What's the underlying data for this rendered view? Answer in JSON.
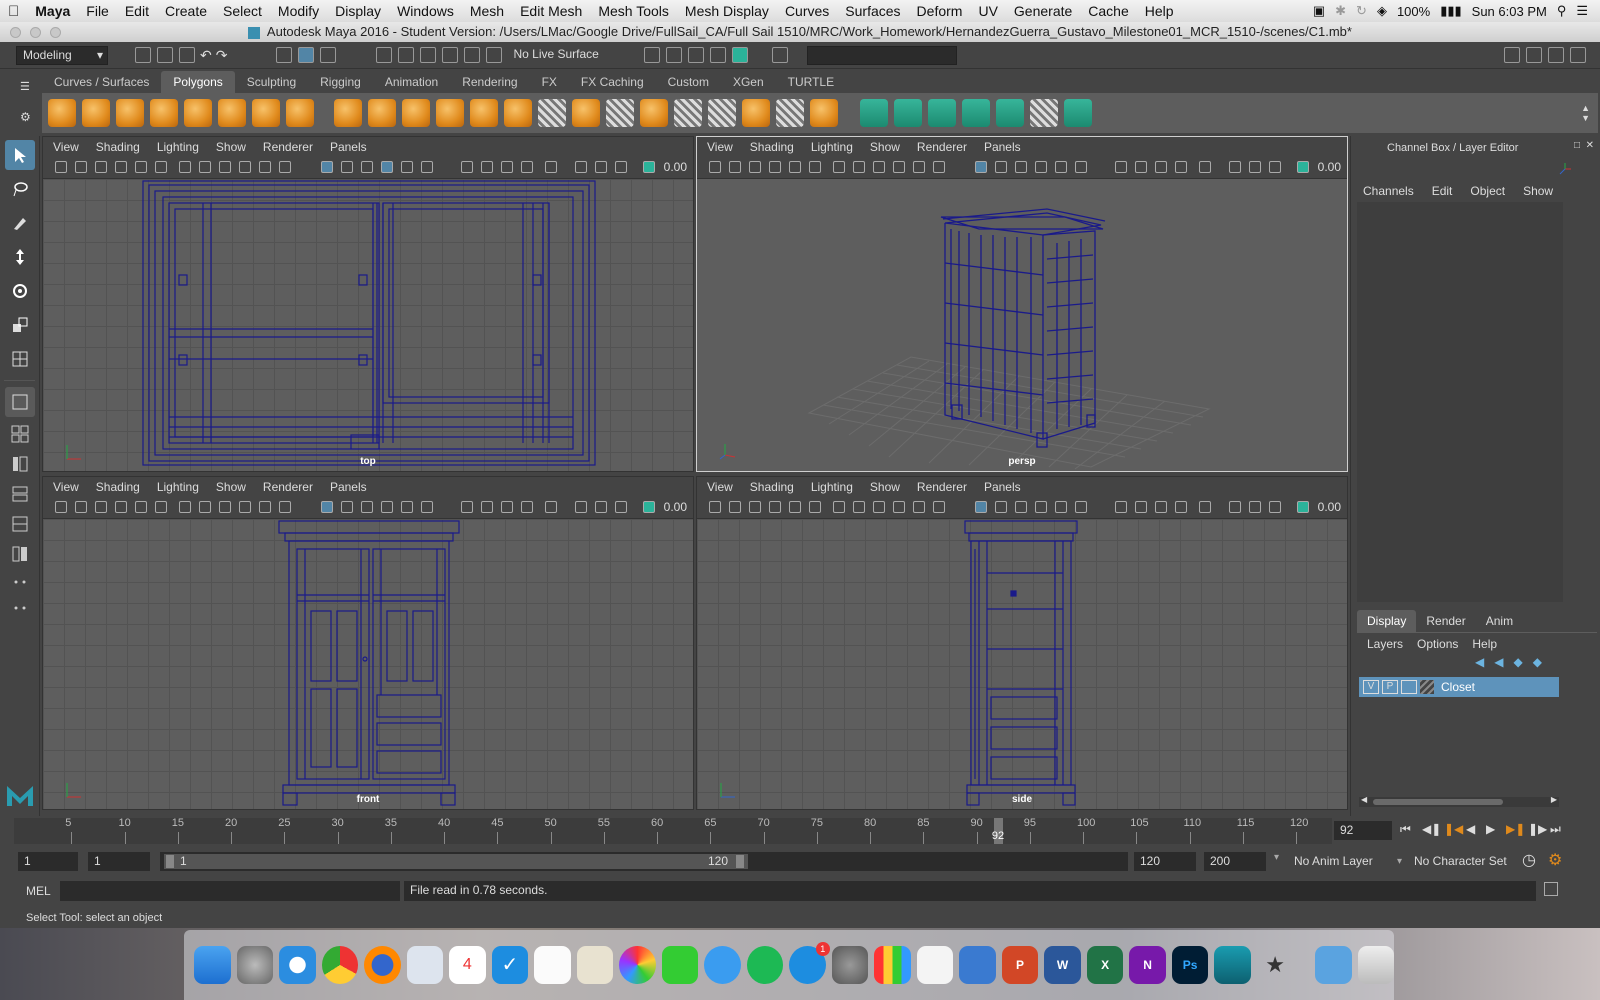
{
  "mac_menubar": {
    "app_name": "Maya",
    "menus": [
      "File",
      "Edit",
      "Create",
      "Select",
      "Modify",
      "Display",
      "Windows",
      "Mesh",
      "Edit Mesh",
      "Mesh Tools",
      "Mesh Display",
      "Curves",
      "Surfaces",
      "Deform",
      "UV",
      "Generate",
      "Cache",
      "Help"
    ],
    "battery": "100%",
    "clock": "Sun 6:03 PM"
  },
  "window_title": "Autodesk Maya 2016 - Student Version: /Users/LMac/Google Drive/FullSail_CA/Full Sail 1510/MRC/Work_Homework/HernandezGuerra_Gustavo_Milestone01_MCR_1510-/scenes/C1.mb*",
  "status_line": {
    "menu_set": "Modeling",
    "live_surface": "No Live Surface"
  },
  "shelf": {
    "tabs": [
      "Curves / Surfaces",
      "Polygons",
      "Sculpting",
      "Rigging",
      "Animation",
      "Rendering",
      "FX",
      "FX Caching",
      "Custom",
      "XGen",
      "TURTLE"
    ],
    "active_tab": "Polygons"
  },
  "viewports": [
    {
      "camera": "top",
      "menus": [
        "View",
        "Shading",
        "Lighting",
        "Show",
        "Renderer",
        "Panels"
      ],
      "value": "0.00"
    },
    {
      "camera": "persp",
      "menus": [
        "View",
        "Shading",
        "Lighting",
        "Show",
        "Renderer",
        "Panels"
      ],
      "value": "0.00"
    },
    {
      "camera": "front",
      "menus": [
        "View",
        "Shading",
        "Lighting",
        "Show",
        "Renderer",
        "Panels"
      ],
      "value": "0.00"
    },
    {
      "camera": "side",
      "menus": [
        "View",
        "Shading",
        "Lighting",
        "Show",
        "Renderer",
        "Panels"
      ],
      "value": "0.00"
    }
  ],
  "channel_box": {
    "title": "Channel Box / Layer Editor",
    "menus": [
      "Channels",
      "Edit",
      "Object",
      "Show"
    ]
  },
  "layer_editor": {
    "tabs": [
      "Display",
      "Render",
      "Anim"
    ],
    "active_tab": "Display",
    "menus": [
      "Layers",
      "Options",
      "Help"
    ],
    "layer": {
      "visible": "V",
      "playback": "P",
      "name": "Closet"
    }
  },
  "timeline": {
    "ticks": [
      "5",
      "10",
      "15",
      "20",
      "25",
      "30",
      "35",
      "40",
      "45",
      "50",
      "55",
      "60",
      "65",
      "70",
      "75",
      "80",
      "85",
      "90",
      "95",
      "100",
      "105",
      "110",
      "115",
      "120"
    ],
    "current_frame_marker": "92",
    "current_frame": "92"
  },
  "range": {
    "start": "1",
    "playback_start": "1",
    "slider_start": "1",
    "slider_end": "120",
    "playback_end": "120",
    "end": "200",
    "anim_layer": "No Anim Layer",
    "character_set": "No Character Set"
  },
  "command_line": {
    "language": "MEL",
    "result": "File read in  0.78 seconds."
  },
  "help_line": "Select Tool: select an object",
  "colors": {
    "wireframe": "#1a1a8a",
    "active_blue": "#5285a6",
    "layer_highlight": "#5e93bb"
  }
}
